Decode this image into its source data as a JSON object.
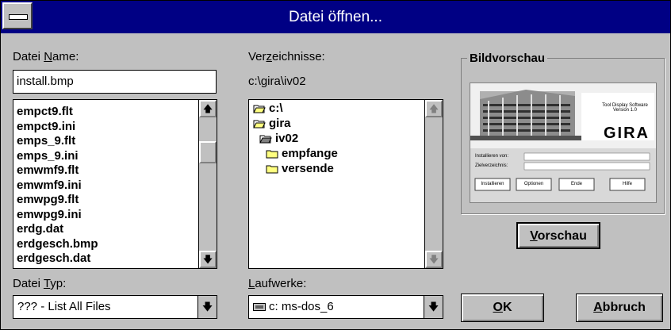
{
  "window": {
    "title": "Datei öffnen..."
  },
  "filename": {
    "label_pre": "Datei ",
    "label_underline": "N",
    "label_post": "ame:",
    "value": "install.bmp"
  },
  "files": [
    "empct9.flt",
    "empct9.ini",
    "emps_9.flt",
    "emps_9.ini",
    "emwmf9.flt",
    "emwmf9.ini",
    "emwpg9.flt",
    "emwpg9.ini",
    "erdg.dat",
    "erdgesch.bmp",
    "erdgesch.dat"
  ],
  "directories": {
    "label_pre": "Ver",
    "label_underline": "z",
    "label_post": "eichnisse:",
    "current_path": "c:\\gira\\iv02",
    "items": [
      "c:\\",
      "gira",
      "iv02",
      "empfange",
      "versende"
    ]
  },
  "filetype": {
    "label_pre": "Datei ",
    "label_underline": "T",
    "label_post": "yp:",
    "value": "??? - List All Files"
  },
  "drives": {
    "label_underline": "L",
    "label_post": "aufwerke:",
    "value": "c: ms-dos_6"
  },
  "preview": {
    "group_title": "Bildvorschau",
    "brand": "GIRA",
    "caption": "Tool Display Software Version 1.0",
    "row1_label": "Installieren von:",
    "row2_label": "Zielverzeichnis:",
    "buttons": [
      "Installieren",
      "Optionen",
      "Ende",
      "Hilfe"
    ],
    "button_pre": "",
    "button_underline": "V",
    "button_post": "orschau"
  },
  "buttons": {
    "ok_underline": "O",
    "ok_post": "K",
    "cancel_underline": "A",
    "cancel_post": "bbruch"
  },
  "colors": {
    "titlebar": "#000084",
    "face": "#c0c0c0"
  }
}
